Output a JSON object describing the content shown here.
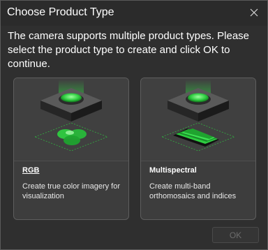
{
  "dialog": {
    "title": "Choose Product Type",
    "message": "The camera supports multiple product types. Please select the product type to create and click OK to continue."
  },
  "cards": [
    {
      "name": "RGB",
      "description": "Create true color imagery for visualization",
      "icon": "rgb-camera-icon"
    },
    {
      "name": "Multispectral",
      "description": "Create multi-band orthomosaics and indices",
      "icon": "multispectral-camera-icon"
    }
  ],
  "buttons": {
    "ok_label": "OK",
    "ok_enabled": false
  },
  "colors": {
    "accent_green": "#2ecc40",
    "background": "#2f2f2f",
    "card_background": "#3d3d3d"
  }
}
